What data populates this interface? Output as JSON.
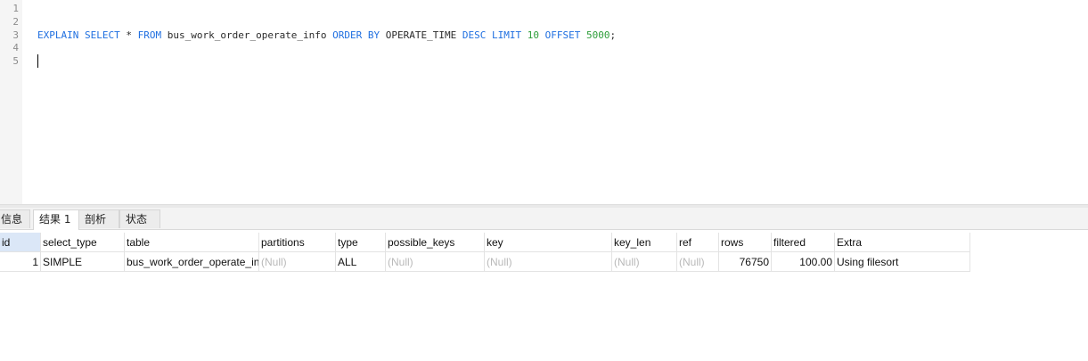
{
  "editor": {
    "line_numbers": [
      "1",
      "2",
      "3",
      "4",
      "5"
    ],
    "sql": {
      "explain": "EXPLAIN",
      "select": "SELECT",
      "star": "*",
      "from": "FROM",
      "table": "bus_work_order_operate_info",
      "order": "ORDER",
      "by": "BY",
      "column": "OPERATE_TIME",
      "desc": "DESC",
      "limit": "LIMIT",
      "limit_value": "10",
      "offset": "OFFSET",
      "offset_value": "5000",
      "terminator": ";"
    }
  },
  "tabs": [
    {
      "label": "信息"
    },
    {
      "label": "结果 1"
    },
    {
      "label": "剖析"
    },
    {
      "label": "状态"
    }
  ],
  "result": {
    "columns": [
      "id",
      "select_type",
      "table",
      "partitions",
      "type",
      "possible_keys",
      "key",
      "key_len",
      "ref",
      "rows",
      "filtered",
      "Extra"
    ],
    "rows": [
      [
        "1",
        "SIMPLE",
        "bus_work_order_operate_info",
        "(Null)",
        "ALL",
        "(Null)",
        "(Null)",
        "(Null)",
        "(Null)",
        "76750",
        "100.00",
        "Using filesort"
      ]
    ]
  }
}
